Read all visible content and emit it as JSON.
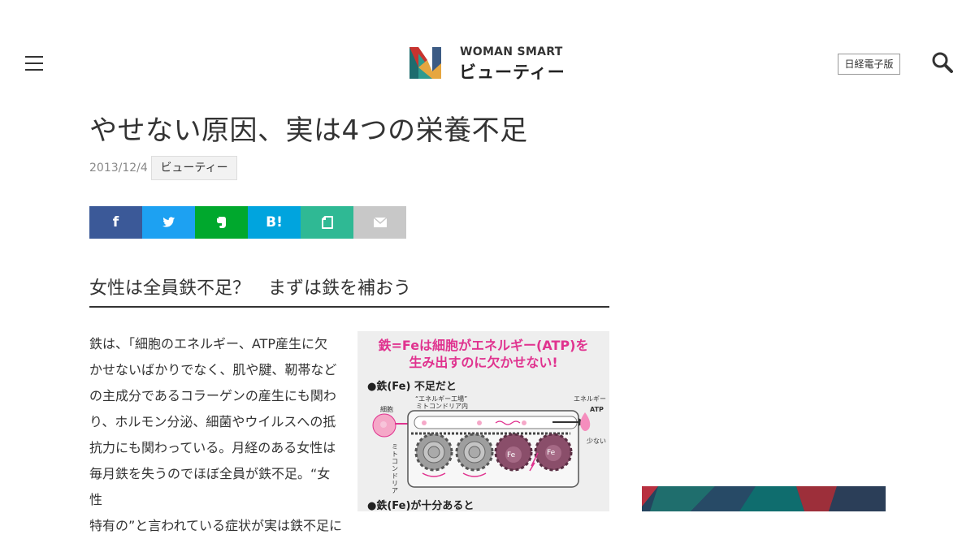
{
  "header": {
    "brand_top": "WOMAN SMART",
    "brand_bottom": "ビューティー",
    "paper_button": "日経電子版"
  },
  "article": {
    "title": "やせない原因、実は4つの栄養不足",
    "date": "2013/12/4",
    "category": "ビューティー",
    "share": {
      "facebook": "f",
      "hatena": "B!"
    },
    "subheading": "女性は全員鉄不足？　まずは鉄を補おう",
    "body_lines": [
      "鉄は、「細胞のエネルギー、ATP産生に欠",
      "かせないばかりでなく、肌や腱、靭帯など",
      "の主成分であるコラーゲンの産生にも関わ",
      "り、ホルモン分泌、細菌やウイルスへの抵",
      "抗力にも関わっている。月経のある女性は",
      "毎月鉄を失うのでほぼ全員が鉄不足。“女性",
      "特有の”と言われている症状が実は鉄不足に"
    ]
  },
  "figure": {
    "title_line1": "鉄=Feは細胞がエネルギー(ATP)を",
    "title_line2": "生み出すのに欠かせない!",
    "case_low": "●鉄(Fe) 不足だと",
    "case_high": "●鉄(Fe)が十分あると",
    "label_factory": "“エネルギー工場”",
    "label_mito_inside": "ミトコンドリア内",
    "label_cell": "細胞",
    "label_energy": "エネルギー",
    "label_atp": "ATP",
    "label_few": "少ない",
    "label_mito_vertical": "ミトコンドリア",
    "label_fe": "Fe"
  },
  "colors": {
    "facebook": "#3b5998",
    "twitter": "#1da1f2",
    "evernote": "#00a82d",
    "hatena": "#00a4de",
    "note": "#2fb994",
    "mail": "#c8c8c8",
    "figure_accent": "#e0338f"
  },
  "icons": [
    "menu-icon",
    "search-icon",
    "facebook-icon",
    "twitter-icon",
    "evernote-icon",
    "hatena-icon",
    "note-icon",
    "mail-icon"
  ]
}
